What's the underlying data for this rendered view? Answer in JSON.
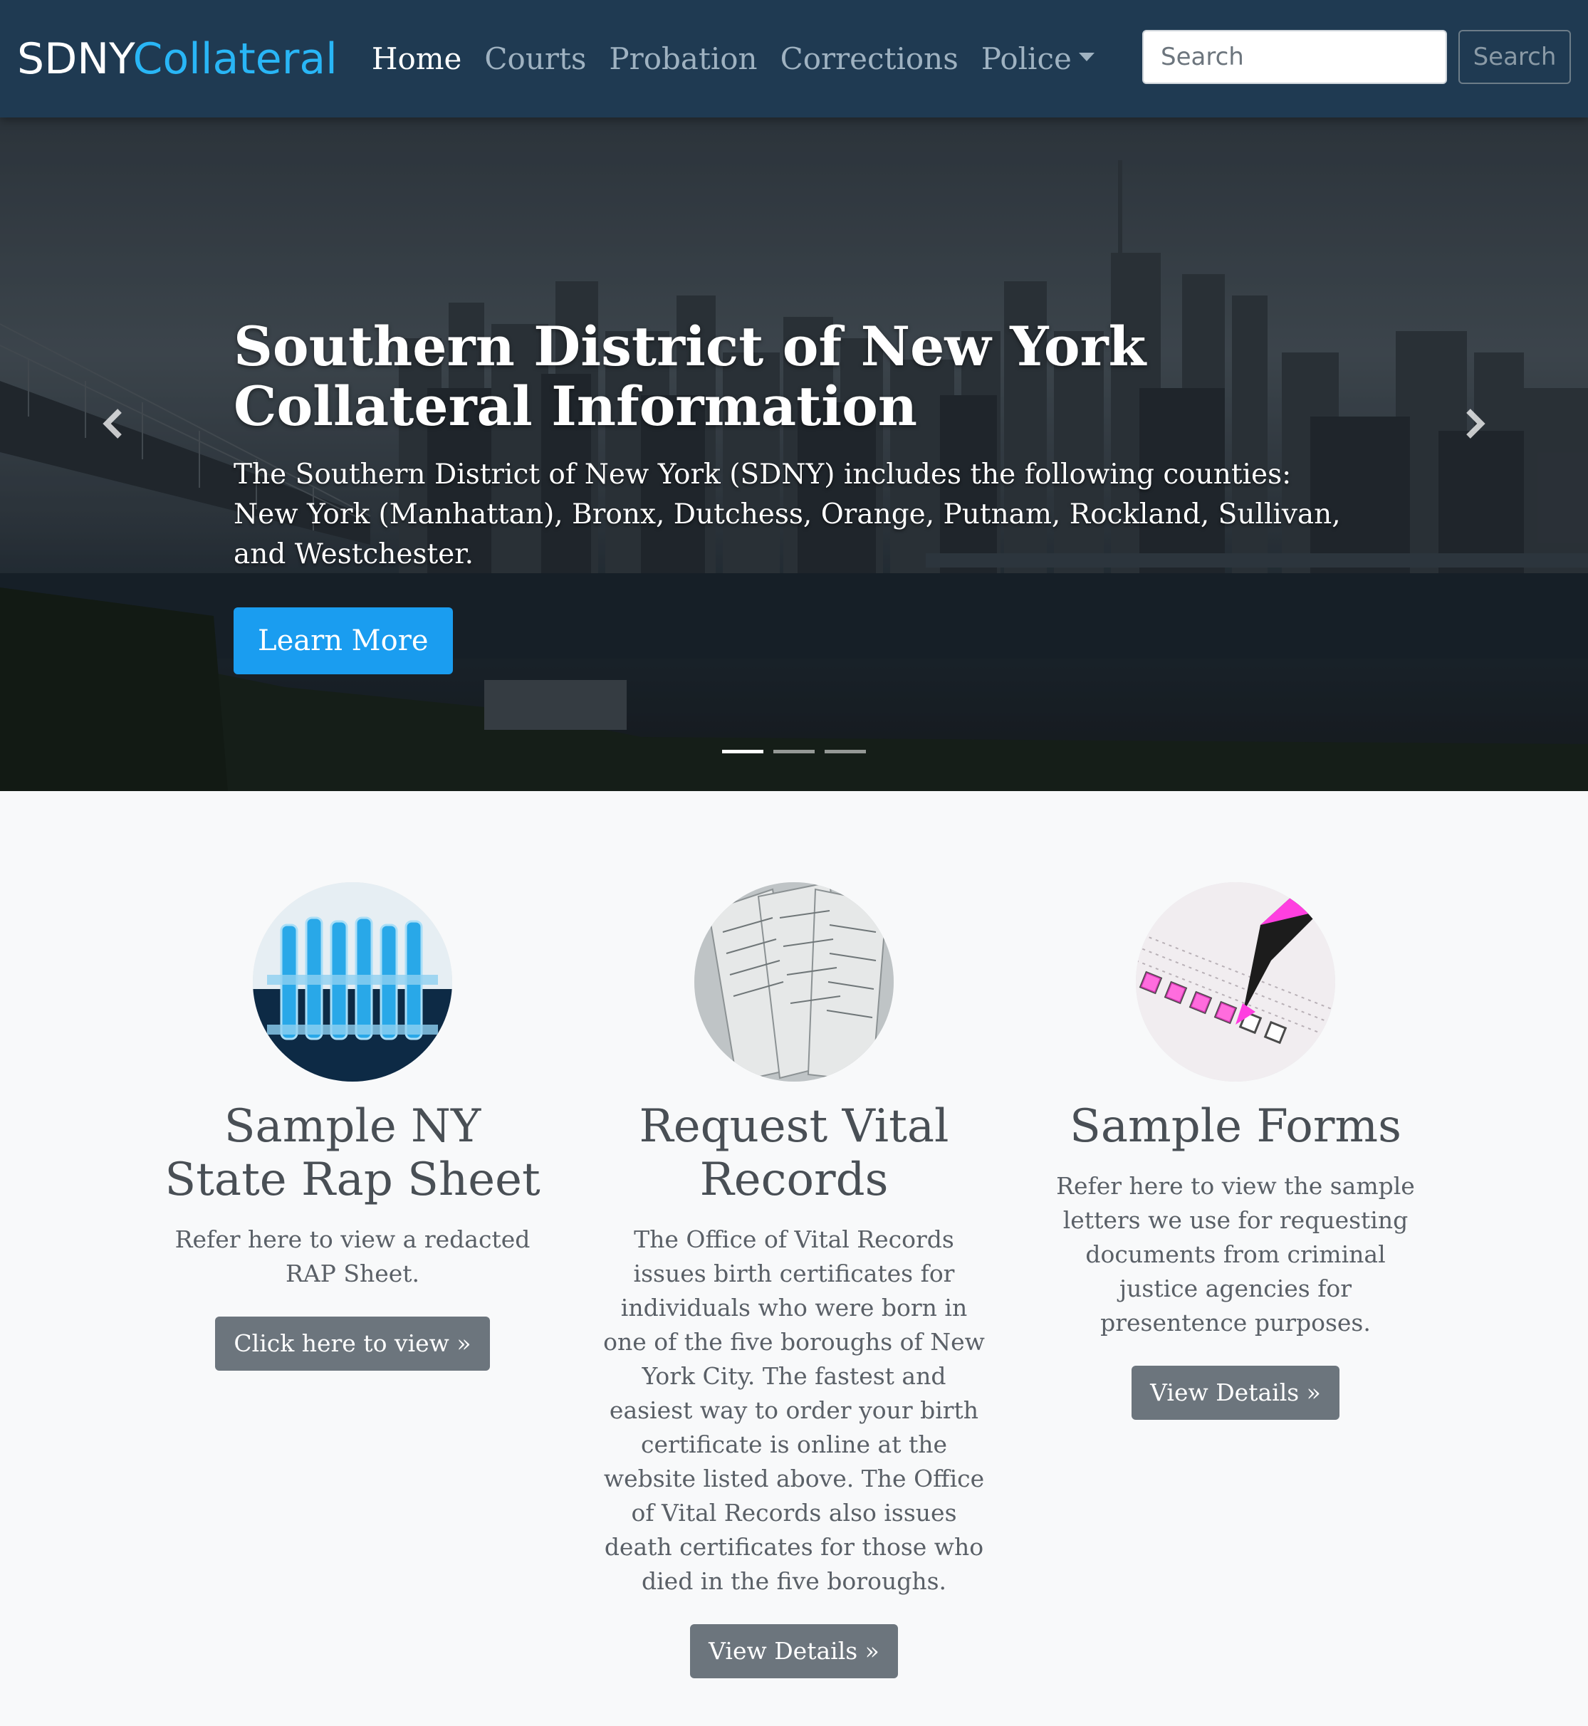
{
  "brand": {
    "part1": "SDNY",
    "part2": "Collateral"
  },
  "nav": {
    "home": "Home",
    "courts": "Courts",
    "probation": "Probation",
    "corrections": "Corrections",
    "police": "Police"
  },
  "search": {
    "placeholder": "Search",
    "button_label": "Search"
  },
  "hero": {
    "title": "Southern District of New York Collateral Information",
    "text": "The Southern District of New York (SDNY) includes the following counties: New York (Manhattan), Bronx, Dutchess, Orange, Putnam, Rockland, Sullivan, and Westchester.",
    "button_label": "Learn More",
    "slide_count": 3,
    "active_slide": 1
  },
  "features": [
    {
      "image_icon": "test-tubes-image",
      "heading": "Sample NY State Rap Sheet",
      "text": "Refer here to view a redacted RAP Sheet.",
      "button_label": "Click here to view »"
    },
    {
      "image_icon": "records-papers-image",
      "heading": "Request Vital Records",
      "text": "The Office of Vital Records issues birth certificates for individuals who were born in one of the five boroughs of New York City. The fastest and easiest way to order your birth certificate is online at the website listed above. The Office of Vital Records also issues death certificates for those who died in the five boroughs.",
      "button_label": "View Details »"
    },
    {
      "image_icon": "checklist-marker-image",
      "heading": "Sample Forms",
      "text": "Refer here to view the sample letters we use for requesting documents from criminal justice agencies for presentence purposes.",
      "button_label": "View Details »"
    }
  ],
  "colors": {
    "navbar": "#1f3a52",
    "brand_accent": "#29b6f6",
    "primary_button": "#1a9df0",
    "secondary_button": "#6c757d"
  }
}
